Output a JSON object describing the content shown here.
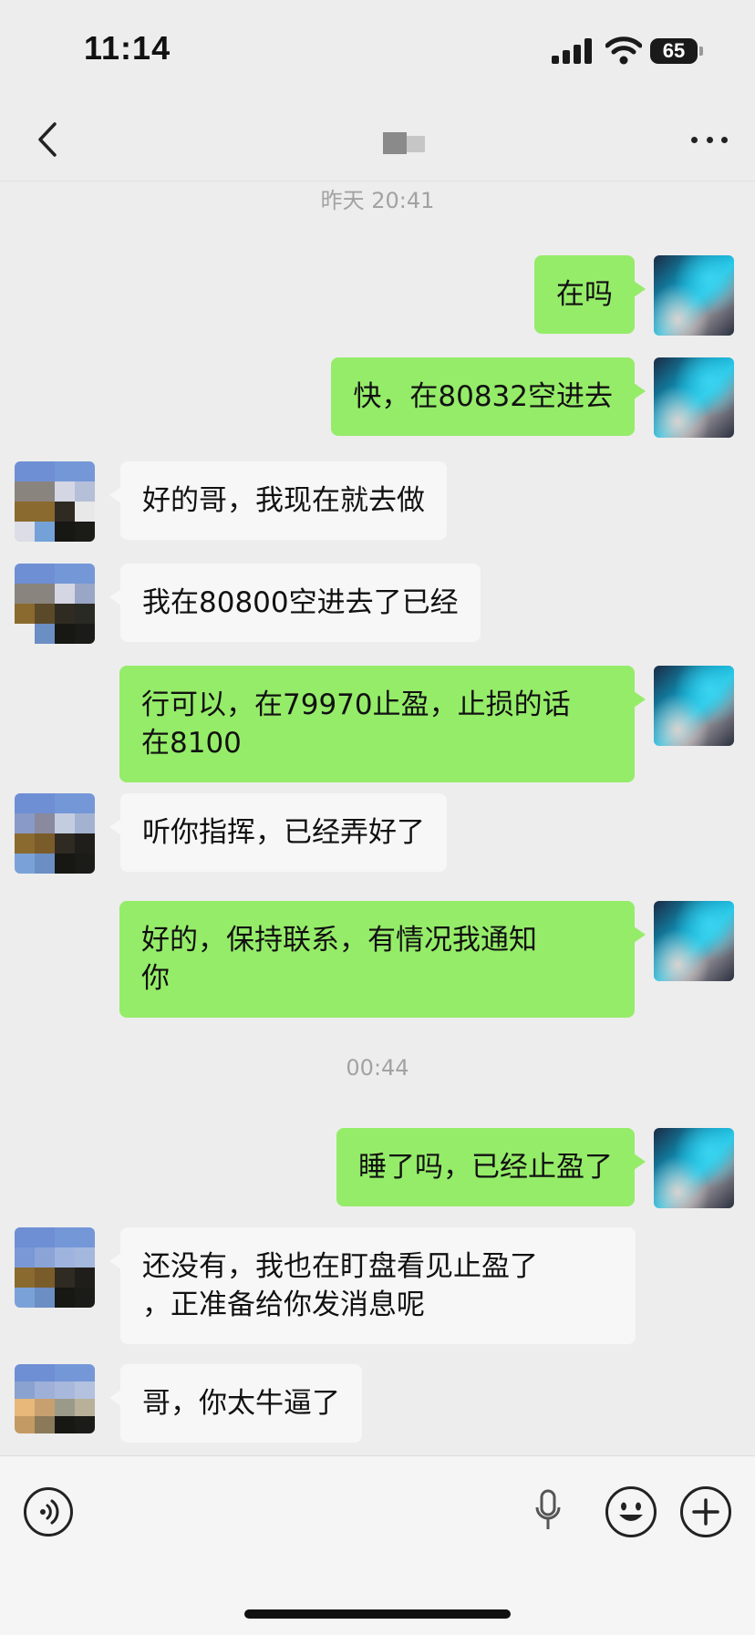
{
  "status_bar": {
    "time": "11:14",
    "battery": "65"
  },
  "header": {
    "back_icon": "chevron-left-icon",
    "more_icon": "ellipsis-icon"
  },
  "timestamps": [
    "昨天 20:41",
    "00:44"
  ],
  "messages": [
    {
      "side": "right",
      "lines": [
        "在吗"
      ]
    },
    {
      "side": "right",
      "lines": [
        "快，在80832空进去"
      ]
    },
    {
      "side": "left",
      "lines": [
        "好的哥，我现在就去做"
      ]
    },
    {
      "side": "left",
      "lines": [
        "我在80800空进去了已经"
      ]
    },
    {
      "side": "right",
      "lines": [
        "行可以，在79970止盈，止损的话",
        "在8100"
      ]
    },
    {
      "side": "left",
      "lines": [
        "听你指挥，已经弄好了"
      ]
    },
    {
      "side": "right",
      "lines": [
        "好的，保持联系，有情况我通知",
        "你"
      ]
    },
    {
      "side": "right",
      "lines": [
        "睡了吗，已经止盈了"
      ]
    },
    {
      "side": "left",
      "lines": [
        "还没有，我也在盯盘看见止盈了",
        "，正准备给你发消息呢"
      ]
    },
    {
      "side": "left",
      "lines": [
        "哥，你太牛逼了"
      ]
    }
  ],
  "input_bar": {
    "voice_icon": "voice-icon",
    "mic_icon": "microphone-icon",
    "emoji_icon": "emoji-icon",
    "add_icon": "plus-icon"
  },
  "colors": {
    "background": "#ededed",
    "self_bubble": "#95ec69",
    "other_bubble": "#f7f7f7",
    "timestamp_text": "#a2a2a2"
  }
}
